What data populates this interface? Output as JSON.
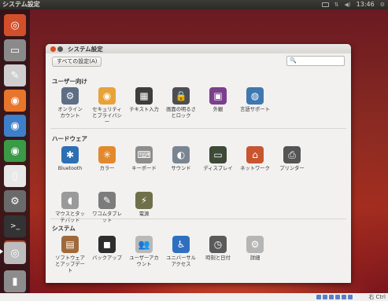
{
  "top_panel": {
    "title": "システム設定",
    "clock": "13:46"
  },
  "window": {
    "title": "システム設定",
    "all_settings": "すべての設定(A)",
    "search_icon": "🔍"
  },
  "sections": {
    "personal": {
      "title": "ユーザー向け",
      "items": [
        {
          "label": "オンライン\nカウント",
          "icon": "online-accounts-icon",
          "glyph": "⚙",
          "color": "#5d6e85"
        },
        {
          "label": "セキュリティ\nとプライバシ\nー",
          "icon": "security-privacy-icon",
          "glyph": "◉",
          "color": "#e8a23a"
        },
        {
          "label": "テキスト入力",
          "icon": "text-entry-icon",
          "glyph": "▦",
          "color": "#3d3d3d"
        },
        {
          "label": "画面の明るさ\nとロック",
          "icon": "brightness-lock-icon",
          "glyph": "🔒",
          "color": "#4b4f55"
        },
        {
          "label": "外観",
          "icon": "appearance-icon",
          "glyph": "▣",
          "color": "#7b3f8c"
        },
        {
          "label": "言語サポート",
          "icon": "language-support-icon",
          "glyph": "◍",
          "color": "#3f78b0"
        }
      ]
    },
    "hardware": {
      "title": "ハードウェア",
      "items": [
        {
          "label": "Bluetooth",
          "icon": "bluetooth-icon",
          "glyph": "✱",
          "color": "#2d6fb5"
        },
        {
          "label": "カラー",
          "icon": "color-icon",
          "glyph": "✳",
          "color": "#e3892d"
        },
        {
          "label": "キーボード",
          "icon": "keyboard-icon",
          "glyph": "⌨",
          "color": "#8d8d8d"
        },
        {
          "label": "サウンド",
          "icon": "sound-icon",
          "glyph": "◐",
          "color": "#7a8592"
        },
        {
          "label": "ディスプレイ",
          "icon": "display-icon",
          "glyph": "▭",
          "color": "#3d4a36"
        },
        {
          "label": "ネットワーク",
          "icon": "network-icon",
          "glyph": "⌂",
          "color": "#c8552f"
        },
        {
          "label": "プリンター",
          "icon": "printer-icon",
          "glyph": "⎙",
          "color": "#555555"
        },
        {
          "label": "マウスとタッ\nチパッド",
          "icon": "mouse-touchpad-icon",
          "glyph": "◖",
          "color": "#9a9a9a"
        },
        {
          "label": "ワコムタブレ\nット",
          "icon": "wacom-tablet-icon",
          "glyph": "✎",
          "color": "#7c7c7c"
        },
        {
          "label": "電源",
          "icon": "power-icon",
          "glyph": "⚡",
          "color": "#6f6f4a"
        }
      ]
    },
    "system": {
      "title": "システム",
      "items": [
        {
          "label": "ソフトウェア\nとアップデー\nト",
          "icon": "software-updates-icon",
          "glyph": "▤",
          "color": "#a1693a"
        },
        {
          "label": "バックアップ",
          "icon": "backup-icon",
          "glyph": "◼",
          "color": "#2e2e2e"
        },
        {
          "label": "ユーザーアカ\nウント",
          "icon": "user-accounts-icon",
          "glyph": "👥",
          "color": "#b9b9b9"
        },
        {
          "label": "ユニバーサル\nアクセス",
          "icon": "universal-access-icon",
          "glyph": "♿",
          "color": "#2f6fbf"
        },
        {
          "label": "時刻と日付",
          "icon": "time-date-icon",
          "glyph": "◷",
          "color": "#5a5a5a"
        },
        {
          "label": "詳細",
          "icon": "details-icon",
          "glyph": "⚙",
          "color": "#b5b5b5"
        }
      ]
    }
  },
  "launcher": [
    {
      "name": "dash-home-icon",
      "glyph": "◎",
      "color": "#d1502b"
    },
    {
      "name": "file-manager-icon",
      "glyph": "▭",
      "color": "#8a8a8a"
    },
    {
      "name": "text-editor-icon",
      "glyph": "✎",
      "color": "#cfcfcf"
    },
    {
      "name": "firefox-icon",
      "glyph": "◉",
      "color": "#e8752c"
    },
    {
      "name": "thunderbird-icon",
      "glyph": "◉",
      "color": "#3f7fc9"
    },
    {
      "name": "chromium-icon",
      "glyph": "◉",
      "color": "#3a9a46"
    },
    {
      "name": "document-icon",
      "glyph": "▯",
      "color": "#e8e8e8"
    },
    {
      "name": "settings-tool-icon",
      "glyph": "⚙",
      "color": "#6a6a6a"
    },
    {
      "name": "terminal-icon",
      "glyph": ">_",
      "color": "#333333"
    },
    {
      "name": "system-settings-icon",
      "glyph": "⚙",
      "color": "#c9421e"
    },
    {
      "name": "dvd-icon",
      "glyph": "◎",
      "color": "#bdbdbd"
    },
    {
      "name": "trash-icon",
      "glyph": "▮",
      "color": "#8c8c8c"
    }
  ],
  "bottom_bar": {
    "host_key": "右 Ctrl"
  }
}
